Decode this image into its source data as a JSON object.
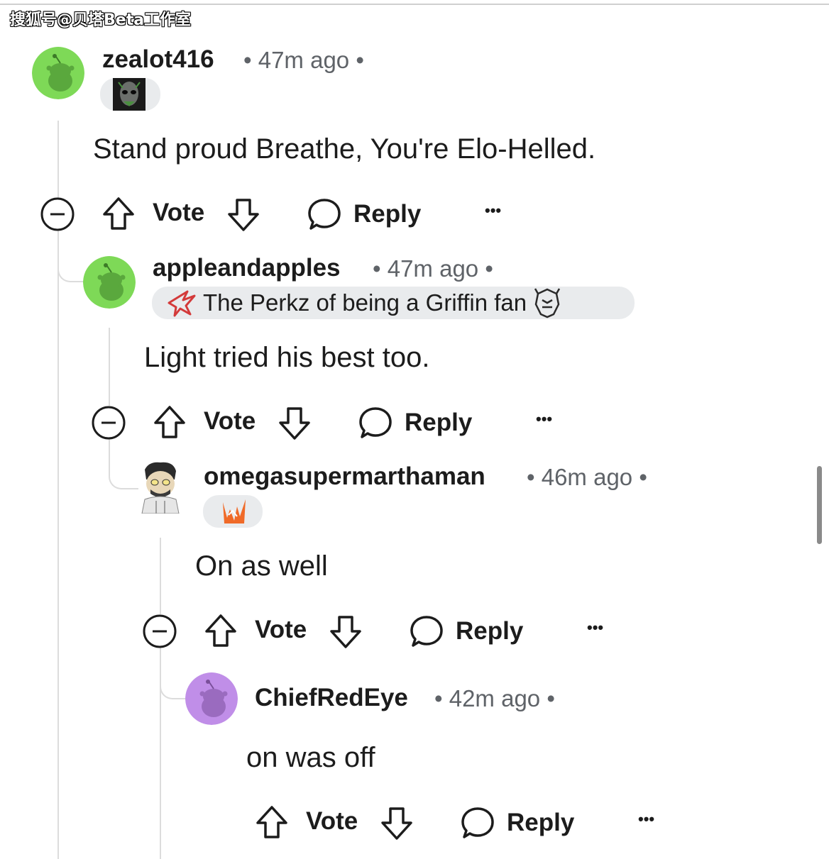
{
  "watermark": "搜狐号@贝塔Beta工作室",
  "action_labels": {
    "vote": "Vote",
    "reply": "Reply",
    "more": "•••"
  },
  "comments": [
    {
      "username": "zealot416",
      "time": "• 47m ago •",
      "avatar_color": "#7ed957",
      "flair_icon": "mask-flair-icon",
      "body": "Stand proud Breathe, You're Elo-Helled."
    },
    {
      "username": "appleandapples",
      "time": "• 47m ago •",
      "avatar_color": "#7ed957",
      "flair_text": "The Perkz of being a Griffin fan",
      "flair_icons": [
        "griffin-logo-icon",
        "g2-logo-icon"
      ],
      "body": "Light tried his best too."
    },
    {
      "username": "omegasupermarthaman",
      "time": "• 46m ago •",
      "avatar_color": "#ffffff",
      "flair_icon": "orange-team-logo-icon",
      "body": "On as well"
    },
    {
      "username": "ChiefRedEye",
      "time": "• 42m ago •",
      "avatar_color": "#c08ee8",
      "body": "on was off"
    }
  ]
}
